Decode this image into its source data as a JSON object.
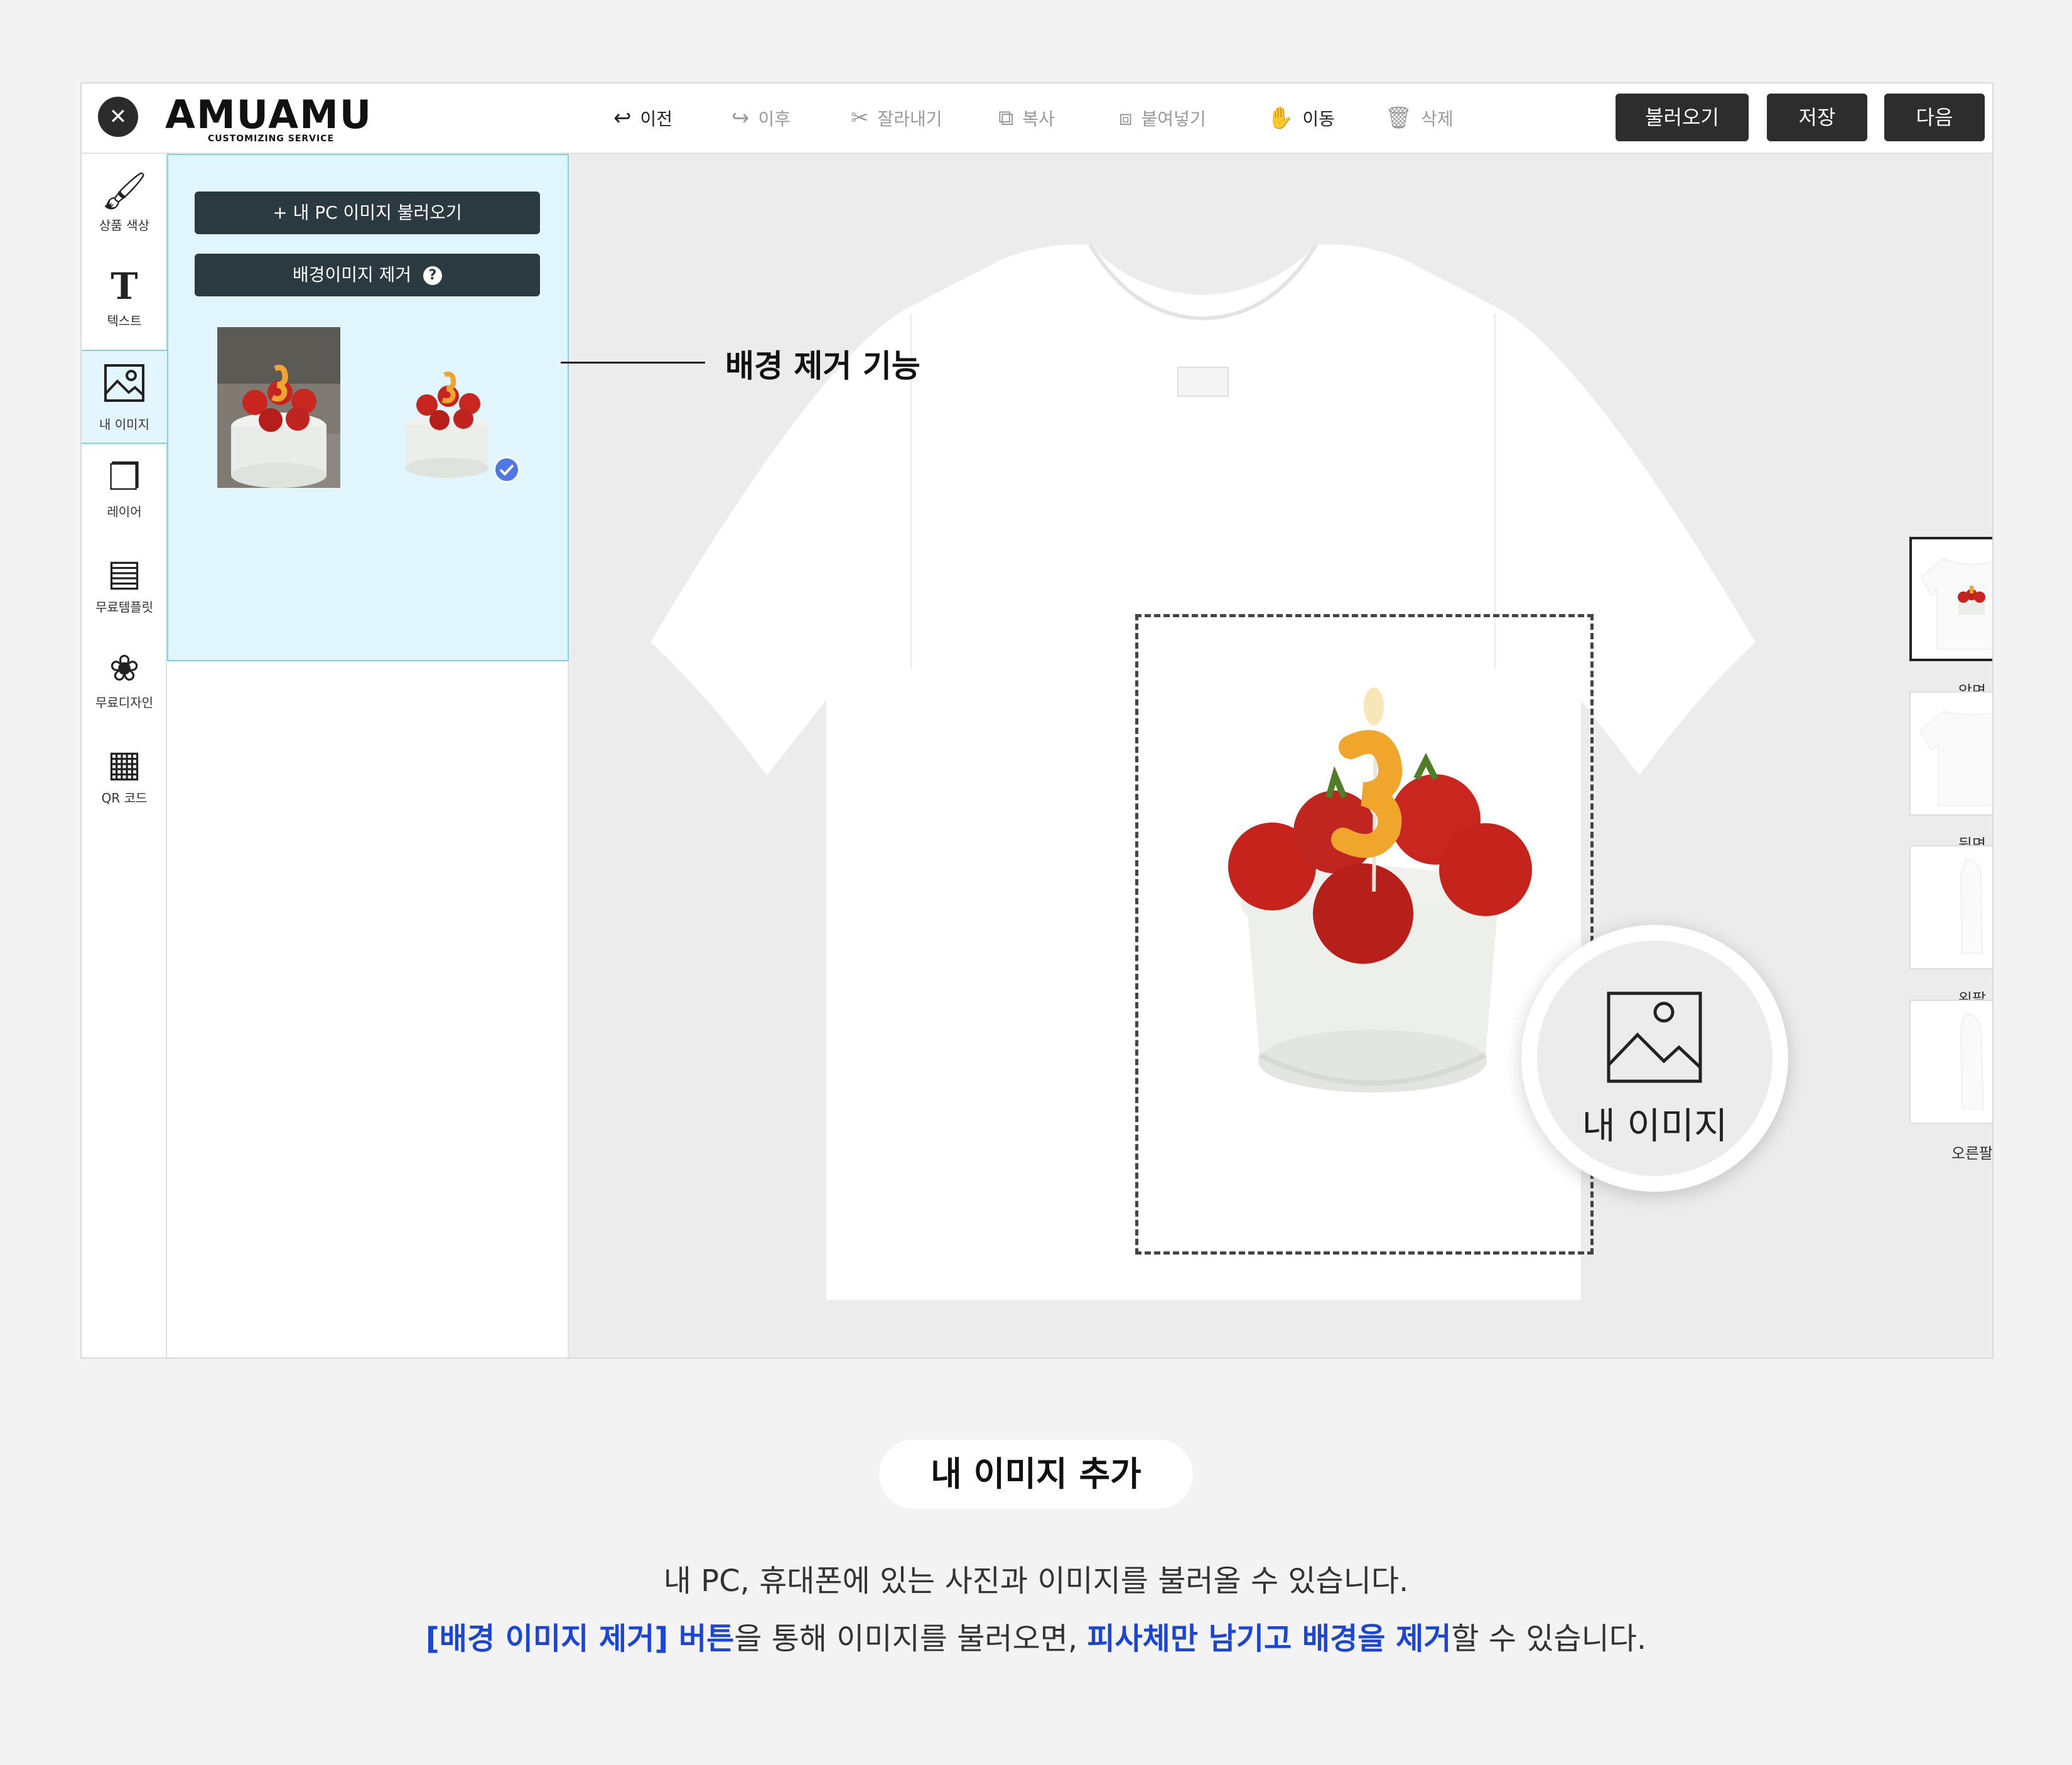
{
  "app": {
    "logo": {
      "main": "AMUAMU",
      "sub": "CUSTOMIZING SERVICE"
    },
    "close_label": "✕",
    "toolbar": [
      {
        "key": "undo",
        "label": "이전",
        "icon": "undo-arrow-icon",
        "glyph": "↩",
        "active": true
      },
      {
        "key": "redo",
        "label": "이후",
        "icon": "redo-arrow-icon",
        "glyph": "↪",
        "active": false
      },
      {
        "key": "cut",
        "label": "잘라내기",
        "icon": "scissors-icon",
        "glyph": "✂",
        "active": false
      },
      {
        "key": "copy",
        "label": "복사",
        "icon": "copy-icon",
        "glyph": "⧉",
        "active": false
      },
      {
        "key": "paste",
        "label": "붙여넣기",
        "icon": "paste-icon",
        "glyph": "⧈",
        "active": false
      },
      {
        "key": "move",
        "label": "이동",
        "icon": "hand-icon",
        "glyph": "✋",
        "active": true
      },
      {
        "key": "delete",
        "label": "삭제",
        "icon": "trash-icon",
        "glyph": "🗑",
        "active": false
      }
    ],
    "actions": {
      "load": "불러오기",
      "save": "저장",
      "next": "다음"
    },
    "rail": [
      {
        "label": "상품 색상",
        "icon": "brush-icon",
        "glyph": "🖌"
      },
      {
        "label": "텍스트",
        "icon": "text-box-icon",
        "glyph": "T"
      },
      {
        "label": "내 이미지",
        "icon": "image-icon",
        "glyph": "🖼"
      },
      {
        "label": "레이어",
        "icon": "layers-icon",
        "glyph": "❐"
      },
      {
        "label": "무료템플릿",
        "icon": "template-icon",
        "glyph": "▤"
      },
      {
        "label": "무료디자인",
        "icon": "design-icon",
        "glyph": "❀"
      },
      {
        "label": "QR 코드",
        "icon": "qr-code-icon",
        "glyph": "▦"
      }
    ],
    "panel": {
      "upload_label": "+ 내 PC 이미지 불러오기",
      "remove_bg_label": "배경이미지 제거",
      "help_glyph": "?"
    },
    "views": [
      {
        "label": "앞면"
      },
      {
        "label": "뒷면"
      },
      {
        "label": "왼팔"
      },
      {
        "label": "오른팔"
      }
    ],
    "callout": "배경 제거 기능",
    "zoom_label": "내 이미지"
  },
  "captions": {
    "pill": "내 이미지 추가",
    "line1": "내 PC, 휴대폰에 있는 사진과 이미지를 불러올 수 있습니다.",
    "line2_hl1": "[배경 이미지 제거] 버튼",
    "line2_mid": "을 통해 이미지를 불러오면, ",
    "line2_hl2": "피사체만 남기고 배경을 제거",
    "line2_end": "할 수 있습니다."
  },
  "colors": {
    "accent_blue": "#1b45d6",
    "panel_active": "#e1f5fd",
    "dark_button": "#2d2d2d"
  }
}
